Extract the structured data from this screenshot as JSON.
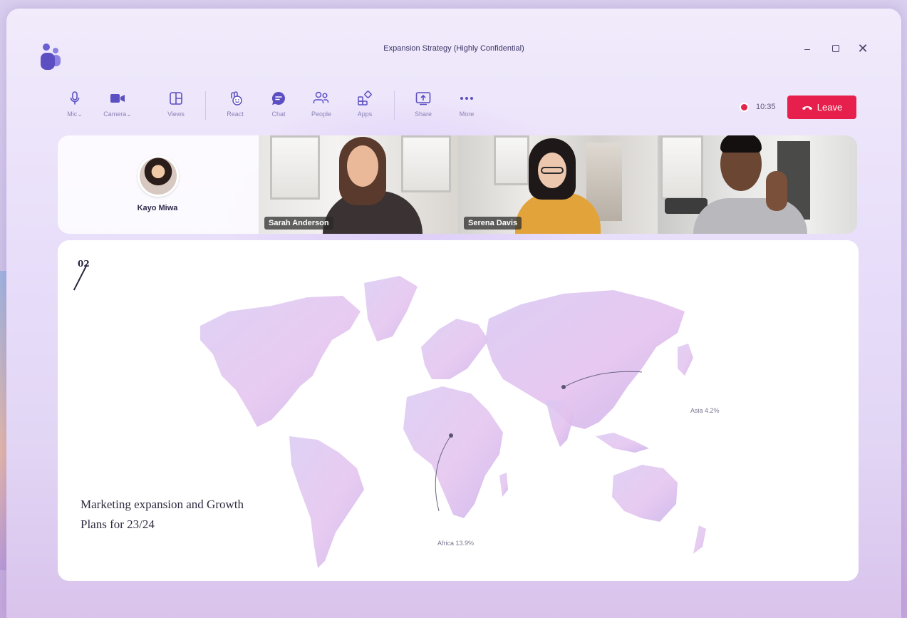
{
  "window": {
    "title": "Expansion Strategy (Highly Confidential)",
    "controls": [
      "minimize",
      "maximize",
      "close"
    ]
  },
  "toolbar": {
    "items": [
      {
        "label": "Mic",
        "icon": "mic-icon",
        "has_dropdown": true
      },
      {
        "label": "Camera",
        "icon": "camera-icon",
        "has_dropdown": true
      },
      {
        "label": "Views",
        "icon": "views-icon"
      },
      {
        "label": "React",
        "icon": "react-icon"
      },
      {
        "label": "Chat",
        "icon": "chat-icon"
      },
      {
        "label": "People",
        "icon": "people-icon"
      },
      {
        "label": "Apps",
        "icon": "apps-icon"
      },
      {
        "label": "Share",
        "icon": "share-icon"
      },
      {
        "label": "More",
        "icon": "more-icon"
      }
    ],
    "timer": "10:35",
    "leave_label": "Leave",
    "leave_color": "#e61f4c",
    "recording_color": "#e0264b"
  },
  "participants": {
    "self_name": "Kayo Miwa",
    "videos": [
      {
        "name": "Sarah Anderson"
      },
      {
        "name": "Serena Davis"
      },
      {
        "name": ""
      }
    ]
  },
  "slide": {
    "number": "02",
    "title": "Marketing expansion and Growth Plans for 23/24",
    "labels": {
      "asia": "Asia 4.2%",
      "africa": "Africa 13.9%"
    }
  },
  "colors": {
    "accent": "#5b4fc2",
    "map_fill": "#d6c2f0"
  }
}
